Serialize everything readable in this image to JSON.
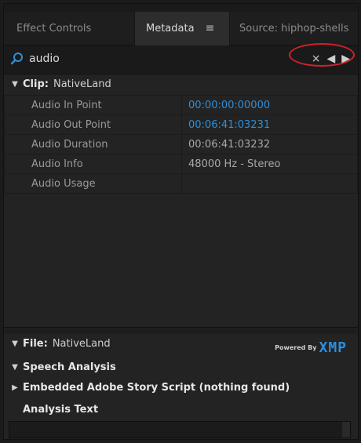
{
  "tabs": [
    {
      "label": "Effect Controls"
    },
    {
      "label": "Metadata",
      "menu": "≡"
    },
    {
      "label": "Source: hiphop-shells"
    }
  ],
  "search": {
    "value": "audio",
    "clear": "×",
    "prev": "◀",
    "next": "▶"
  },
  "clip": {
    "name": "Clip:",
    "value": "NativeLand"
  },
  "rows": [
    {
      "key": "Audio In Point",
      "value": "00:00:00:00000"
    },
    {
      "key": "Audio Out Point",
      "value": "00:06:41:03231"
    },
    {
      "key": "Audio Duration",
      "value": "00:06:41:03232"
    },
    {
      "key": "Audio Info",
      "value": "48000 Hz - Stereo"
    },
    {
      "key": "Audio Usage",
      "value": ""
    }
  ],
  "file": {
    "name": "File:",
    "value": "NativeLand"
  },
  "powered": {
    "by": "Powered By",
    "brand": "XMP"
  },
  "speech": {
    "label": "Speech Analysis"
  },
  "story": {
    "label": "Embedded Adobe Story Script (nothing found)"
  },
  "analysis": {
    "label": "Analysis Text"
  }
}
